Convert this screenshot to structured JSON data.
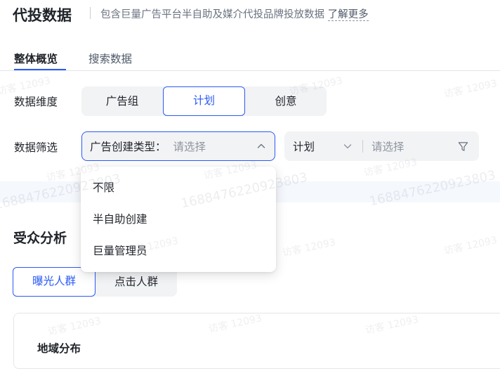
{
  "header": {
    "title": "代投数据",
    "subtitle": "包含巨量广告平台半自助及媒介代投品牌投放数据",
    "learn_more": "了解更多"
  },
  "tabs": [
    {
      "label": "整体概览",
      "active": true
    },
    {
      "label": "搜索数据",
      "active": false
    }
  ],
  "dimension": {
    "label": "数据维度",
    "options": [
      {
        "label": "广告组",
        "active": false
      },
      {
        "label": "计划",
        "active": true
      },
      {
        "label": "创意",
        "active": false
      }
    ]
  },
  "filter": {
    "label": "数据筛选",
    "select_prefix": "广告创建类型：",
    "select_placeholder": "请选择",
    "combo_selected": "计划",
    "combo_placeholder": "请选择"
  },
  "dropdown": {
    "items": [
      "不限",
      "半自助创建",
      "巨量管理员"
    ]
  },
  "audience": {
    "title": "受众分析",
    "options": [
      {
        "label": "曝光人群",
        "active": true
      },
      {
        "label": "点击人群",
        "active": false
      }
    ],
    "card_title": "地域分布"
  },
  "watermark": {
    "visitor": "访客 12093",
    "number": "1688476220923803"
  },
  "colors": {
    "accent": "#2b5af5",
    "segment_bg": "#f2f3f5",
    "text": "#1f2329",
    "placeholder": "#8f959e"
  },
  "icons": [
    "chevron-up-icon",
    "chevron-down-icon",
    "filter-icon"
  ]
}
